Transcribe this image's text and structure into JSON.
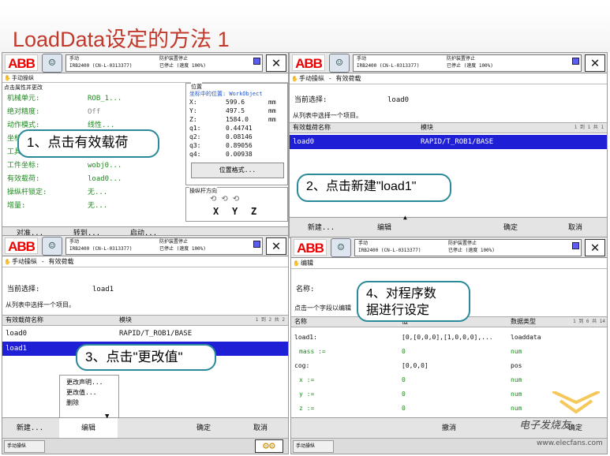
{
  "slide": {
    "title": "LoadData设定的方法 1"
  },
  "common": {
    "status_line1": "手动",
    "status_line2": "IRB2400 (CN-L-0313377)",
    "status_right1": "防护装置停止",
    "status_right2": "已停止 (速度 100%)",
    "close": "✕",
    "taskbar_item": "手动操纵"
  },
  "panel1": {
    "subtitle": "手动操纵",
    "section_left": "点击属性并更改",
    "section_right": "位置",
    "coord_caption": "坐标中的位置: WorkObject",
    "rows": [
      {
        "label": "机械单元:",
        "value": "ROB_1..."
      },
      {
        "label": "绝对精度:",
        "value": "Off"
      },
      {
        "label": "动作模式:",
        "value": "线性..."
      },
      {
        "label": "坐标",
        "value": ""
      },
      {
        "label": "工具",
        "value": ""
      },
      {
        "label": "工件坐标:",
        "value": "wobj0..."
      },
      {
        "label": "有效载荷:",
        "value": "load0..."
      },
      {
        "label": "操纵杆锁定:",
        "value": "无..."
      },
      {
        "label": "增量:",
        "value": "无..."
      }
    ],
    "positions": [
      {
        "axis": "X:",
        "value": "599.6",
        "unit": "mm"
      },
      {
        "axis": "Y:",
        "value": "497.5",
        "unit": "mm"
      },
      {
        "axis": "Z:",
        "value": "1584.0",
        "unit": "mm"
      },
      {
        "axis": "q1:",
        "value": "0.44741",
        "unit": ""
      },
      {
        "axis": "q2:",
        "value": "0.08146",
        "unit": ""
      },
      {
        "axis": "q3:",
        "value": "0.89056",
        "unit": ""
      },
      {
        "axis": "q4:",
        "value": "0.00938",
        "unit": ""
      }
    ],
    "position_format_button": "位置格式...",
    "joystick_caption": "操纵杆方向",
    "axes": [
      "X",
      "Y",
      "Z"
    ],
    "footer": [
      "对准...",
      "转到...",
      "启动..."
    ],
    "callout": "1、点击有效载荷"
  },
  "panel2": {
    "subtitle": "手动操纵 - 有效荷载",
    "current_label": "当前选择:",
    "current_value": "load0",
    "instruction": "从列表中选择一个项目。",
    "col1": "有效载荷名称",
    "col2": "模块",
    "paging": "1 到 1 共 1",
    "row_name": "load0",
    "row_module": "RAPID/T_ROB1/BASE",
    "footer": [
      "新建...",
      "编辑",
      "确定",
      "取消"
    ],
    "callout": "2、点击新建\"load1\""
  },
  "panel3": {
    "subtitle": "手动操纵 - 有效荷载",
    "current_label": "当前选择:",
    "current_value": "load1",
    "instruction": "从列表中选择一个项目。",
    "col1": "有效载荷名称",
    "col2": "模块",
    "paging": "1 到 2 共 2",
    "rows": [
      {
        "name": "load0",
        "module": "RAPID/T_ROB1/BASE"
      },
      {
        "name": "load1",
        "module": ""
      }
    ],
    "menu": [
      "更改声明...",
      "更改值...",
      "删除"
    ],
    "footer": [
      "新建...",
      "编辑",
      "确定",
      "取消"
    ],
    "callout": "3、点击\"更改值\""
  },
  "panel4": {
    "subtitle": "编辑",
    "name_label": "名称:",
    "instruction": "点击一个字段以编辑",
    "col1": "名称",
    "col2": "值",
    "col3": "数据类型",
    "paging": "1 到 6 共 14",
    "rows": [
      {
        "name": "load1:",
        "value": "[0,[0,0,0],[1,0,0,0],...",
        "type": "loaddata",
        "green": false
      },
      {
        "name": "mass :=",
        "value": "0",
        "type": "num",
        "green": true
      },
      {
        "name": "cog:",
        "value": "[0,0,0]",
        "type": "pos",
        "green": false
      },
      {
        "name": "x :=",
        "value": "0",
        "type": "num",
        "green": true
      },
      {
        "name": "y :=",
        "value": "0",
        "type": "num",
        "green": true
      },
      {
        "name": "z :=",
        "value": "0",
        "type": "num",
        "green": true
      }
    ],
    "footer_undo": "撤消",
    "footer_ok": "确定",
    "callout": "4、对程序数\n据进行设定"
  },
  "watermark": {
    "brand": "电子发烧友",
    "url": "www.elecfans.com"
  }
}
